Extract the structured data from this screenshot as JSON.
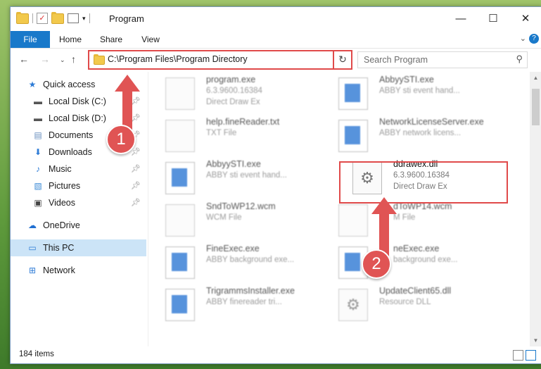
{
  "window": {
    "title": "Program"
  },
  "ribbon": {
    "tabs": [
      "File",
      "Home",
      "Share",
      "View"
    ]
  },
  "address": {
    "path": "C:\\Program Files\\Program Directory"
  },
  "search": {
    "placeholder": "Search Program"
  },
  "sidebar": {
    "items": [
      {
        "label": "Quick access",
        "icon": "star-icon"
      },
      {
        "label": "Local Disk (C:)",
        "icon": "drive-icon",
        "pinned": true
      },
      {
        "label": "Local Disk (D:)",
        "icon": "drive-icon",
        "pinned": true
      },
      {
        "label": "Documents",
        "icon": "documents-icon",
        "pinned": true
      },
      {
        "label": "Downloads",
        "icon": "downloads-icon",
        "pinned": true
      },
      {
        "label": "Music",
        "icon": "music-icon",
        "pinned": true
      },
      {
        "label": "Pictures",
        "icon": "pictures-icon",
        "pinned": true
      },
      {
        "label": "Videos",
        "icon": "videos-icon",
        "pinned": true
      },
      {
        "label": "OneDrive",
        "icon": "onedrive-icon"
      },
      {
        "label": "This PC",
        "icon": "pc-icon",
        "selected": true
      },
      {
        "label": "Network",
        "icon": "network-icon"
      }
    ]
  },
  "files": [
    {
      "name": "program.exe",
      "line2": "6.3.9600.16384",
      "line3": "Direct Draw Ex"
    },
    {
      "name": "AbbyySTI.exe",
      "line2": "ABBY sti event hand...",
      "line3": ""
    },
    {
      "name": "help.fineReader.txt",
      "line2": "TXT File",
      "line3": ""
    },
    {
      "name": "NetworkLicenseServer.exe",
      "line2": "ABBY network licens...",
      "line3": ""
    },
    {
      "name": "AbbyySTI.exe",
      "line2": "ABBY sti event hand...",
      "line3": ""
    },
    {
      "name": "ddrawex.dll",
      "line2": "6.3.9600.16384",
      "line3": "Direct Draw Ex"
    },
    {
      "name": "SndToWP12.wcm",
      "line2": "WCM File",
      "line3": ""
    },
    {
      "name": "dToWP14.wcm",
      "line2": "M File",
      "line3": ""
    },
    {
      "name": "FineExec.exe",
      "line2": "ABBY background exe...",
      "line3": ""
    },
    {
      "name": "neExec.exe",
      "line2": "background exe...",
      "line3": ""
    },
    {
      "name": "TrigrammsInstaller.exe",
      "line2": "ABBY finereader tri...",
      "line3": ""
    },
    {
      "name": "UpdateClient65.dll",
      "line2": "Resource DLL",
      "line3": ""
    }
  ],
  "status": {
    "count": "184 items"
  },
  "annotations": {
    "step1": "1",
    "step2": "2"
  },
  "colors": {
    "accent": "#1979ca",
    "highlight": "#e04a4a"
  }
}
